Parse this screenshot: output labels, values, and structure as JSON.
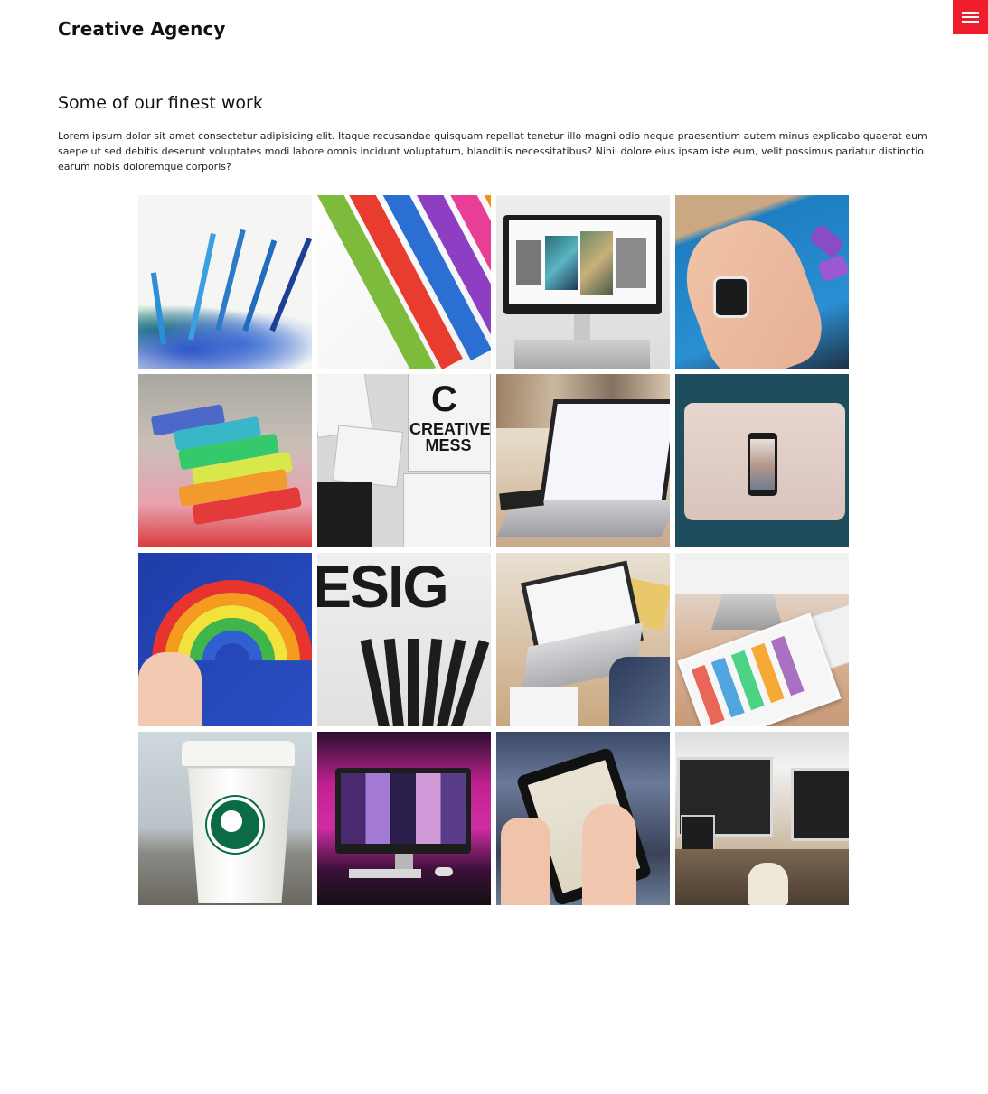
{
  "header": {
    "brand": "Creative Agency",
    "menu_button_icon": "hamburger-menu-icon",
    "accent_color": "#ef1c2b"
  },
  "portfolio": {
    "title": "Some of our finest work",
    "description": "Lorem ipsum dolor sit amet consectetur adipisicing elit. Itaque recusandae quisquam repellat tenetur illo magni odio neque praesentium autem minus explicabo quaerat eum saepe ut sed debitis deserunt voluptates modi labore omnis incidunt voluptatum, blanditiis necessitatibus? Nihil dolore eius ipsam iste eum, velit possimus pariatur distinctio earum nobis doloremque corporis?",
    "tiles": [
      {
        "subject": "blue-pencils-with-shavings"
      },
      {
        "subject": "colored-pencils"
      },
      {
        "subject": "imac-with-artwork"
      },
      {
        "subject": "smartwatch-on-wrist"
      },
      {
        "subject": "colored-pastels"
      },
      {
        "subject": "creative-mess-posters",
        "text_big": "C",
        "text_main": "CREATIVE MESS"
      },
      {
        "subject": "laptop-on-desk"
      },
      {
        "subject": "phone-on-laptop"
      },
      {
        "subject": "rainbow-clay-in-hand"
      },
      {
        "subject": "design-word-with-pencils",
        "text_main": "ESIG"
      },
      {
        "subject": "macbook-workspace"
      },
      {
        "subject": "imac-and-ipad"
      },
      {
        "subject": "starbucks-coffee-cup"
      },
      {
        "subject": "imac-pink-light"
      },
      {
        "subject": "ipad-maps-in-hands"
      },
      {
        "subject": "dual-monitor-workspace"
      }
    ]
  }
}
